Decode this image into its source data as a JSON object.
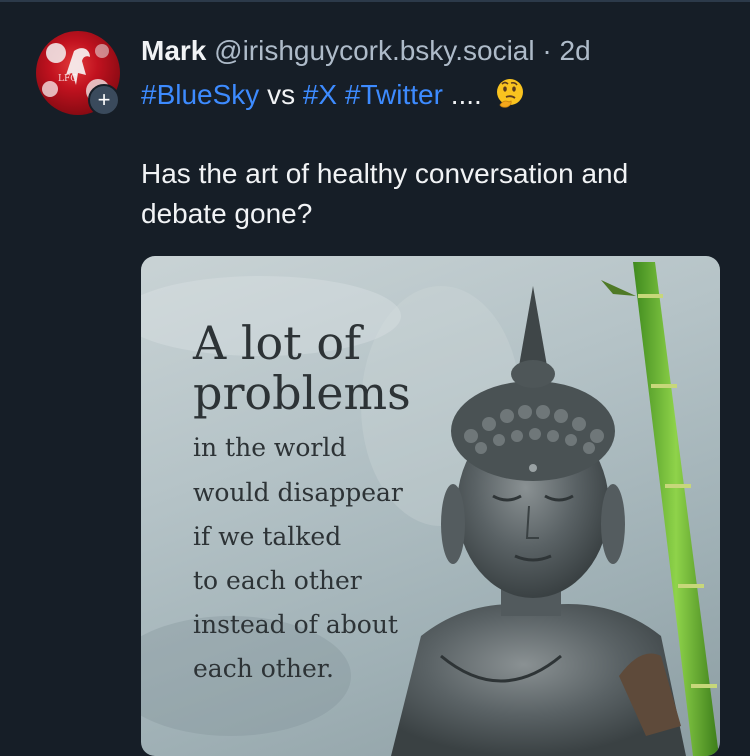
{
  "post": {
    "author": {
      "name": "Mark",
      "handle": "@irishguycork.bsky.social",
      "separator": "·",
      "time": "2d",
      "avatar_icon": "liverbird-avatar",
      "follow_icon": "plus-icon"
    },
    "tags_line": {
      "tag1": "#BlueSky",
      "vs": "vs",
      "tag2": "#X",
      "tag3": "#Twitter",
      "dots": "....",
      "emoji": "thinking-face-emoji"
    },
    "text": "Has the art of healthy conversation and debate gone?",
    "image": {
      "line1": "A lot of",
      "line2": "problems",
      "line3": "in the world",
      "line4": "would disappear",
      "line5": "if we talked",
      "line6": "to each other",
      "line7": "instead of about",
      "line8": "each other."
    }
  },
  "colors": {
    "background": "#161e27",
    "hashtag": "#3d8bff",
    "muted": "#aebbc9",
    "text": "#f1f3f5"
  }
}
